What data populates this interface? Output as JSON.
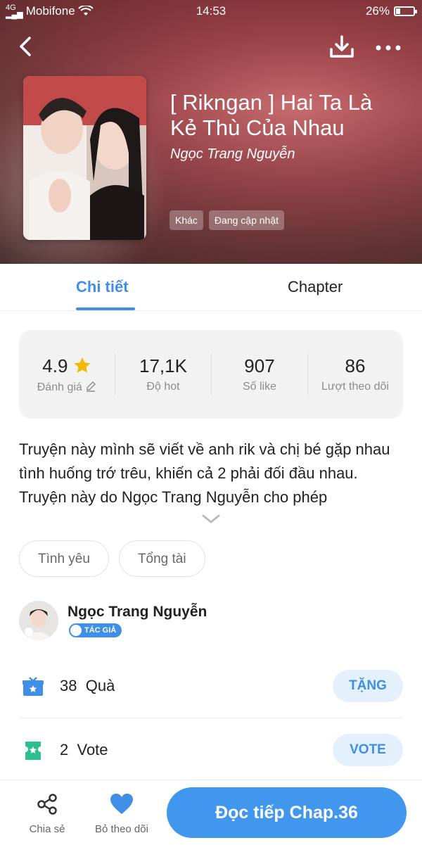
{
  "status_bar": {
    "carrier": "Mobifone",
    "time": "14:53",
    "battery": "26%",
    "battery_level": 0.26
  },
  "book": {
    "title": "[ Rikngan ] Hai Ta Là Kẻ Thù Của Nhau",
    "author": "Ngọc Trang Nguyễn",
    "genre_chip": "Khác",
    "status_chip": "Đang cập nhật"
  },
  "tabs": {
    "detail": "Chi tiết",
    "chapter": "Chapter"
  },
  "stats": [
    {
      "value": "4.9",
      "label": "Đánh giá"
    },
    {
      "value": "17,1K",
      "label": "Độ hot"
    },
    {
      "value": "907",
      "label": "Số like"
    },
    {
      "value": "86",
      "label": "Lượt theo dõi"
    }
  ],
  "description": "Truyện này mình sẽ viết về anh rik và chị bé gặp nhau tình huống trớ trêu, khiến cả 2 phải đối đầu nhau. Truyện này do Ngọc Trang Nguyễn cho phép",
  "tags": [
    "Tình yêu",
    "Tổng tài"
  ],
  "author_section": {
    "name": "Ngọc Trang Nguyễn",
    "badge": "TÁC GIẢ"
  },
  "gift_row": {
    "count": "38",
    "label": "Quà",
    "button": "TẶNG"
  },
  "vote_row": {
    "count": "2",
    "label": "Vote",
    "button": "VOTE"
  },
  "bottom_bar": {
    "share": "Chia sẻ",
    "unfollow": "Bỏ theo dõi",
    "read_button": "Đọc tiếp Chap.36"
  },
  "colors": {
    "accent": "#3f8fe6",
    "button_light": "#e4f0fc",
    "star": "#f5b800",
    "gift": "#3f8fe6",
    "vote": "#2fbf8f"
  },
  "icons": [
    "back-arrow-icon",
    "download-icon",
    "more-icon",
    "star-icon",
    "edit-icon",
    "chevron-down-icon",
    "gift-icon",
    "ticket-icon",
    "share-icon",
    "heart-icon"
  ]
}
